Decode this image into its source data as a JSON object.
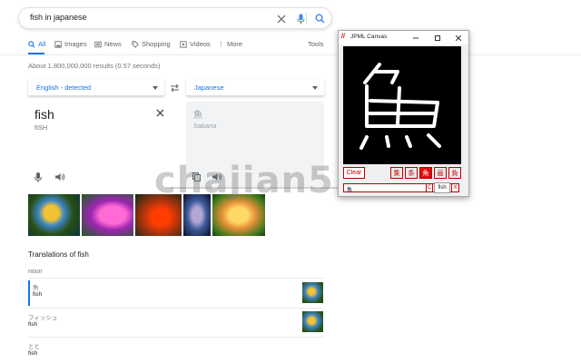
{
  "search": {
    "query": "fish in japanese"
  },
  "tabs": [
    {
      "label": "All"
    },
    {
      "label": "Images"
    },
    {
      "label": "News"
    },
    {
      "label": "Shopping"
    },
    {
      "label": "Videos"
    },
    {
      "label": "More"
    }
  ],
  "tools_label": "Tools",
  "result_stats": "About 1,800,000,000 results (0.57 seconds)",
  "translate": {
    "source_lang": "English - detected",
    "target_lang": "Japanese",
    "source_text": "fish",
    "source_phonetic": "fiSH",
    "target_text": "魚",
    "target_romaji": "Sakana"
  },
  "translations": {
    "title": "Translations of fish",
    "pos": "noun",
    "entries": [
      {
        "word": "魚",
        "trans": "fish"
      },
      {
        "word": "フィッシュ",
        "trans": "fish"
      },
      {
        "word": "とと",
        "trans": "fish"
      }
    ]
  },
  "jpml": {
    "title": "JPML Canvas",
    "clear_label": "Clear",
    "candidates": [
      "集",
      "条",
      "魚",
      "画",
      "負"
    ],
    "selected_index": 2,
    "input_value": "魚",
    "copy_label": "C",
    "close_label": "X",
    "tooltip": "fish"
  },
  "watermark": "chajian5.com",
  "colors": {
    "accent": "#1a73e8",
    "jpml_red": "#cc0000"
  }
}
